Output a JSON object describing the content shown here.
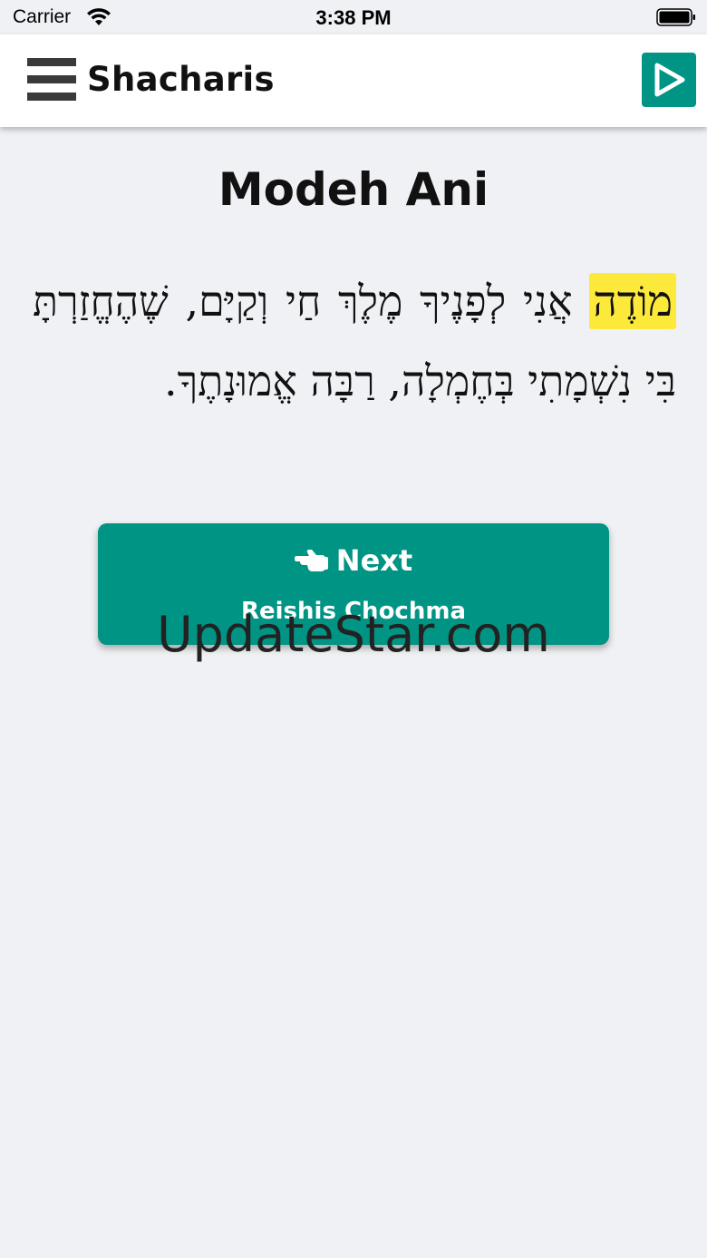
{
  "status_bar": {
    "carrier": "Carrier",
    "time": "3:38 PM"
  },
  "nav": {
    "title": "Shacharis",
    "menu_icon": "hamburger-menu-icon",
    "play_icon": "play-icon"
  },
  "prayer": {
    "title": "Modeh Ani",
    "highlighted_word": "מוֹדֶה",
    "text_rest": "אֲנִי לְפָנֶיךָ מֶלֶךְ חַי וְקַיָּם, שֶׁהֶחֱזַרְתָּ בִּי נִשְׁמָתִי בְּחֶמְלָה, רַבָּה אֱמוּנָתֶךָ."
  },
  "next_button": {
    "icon": "pointing-hand-icon",
    "label": "Next",
    "subtitle": "Reishis Chochma"
  },
  "watermark": "UpdateStar.com",
  "colors": {
    "accent": "#009485",
    "highlight": "#fde93a",
    "background": "#f0f1f4"
  }
}
